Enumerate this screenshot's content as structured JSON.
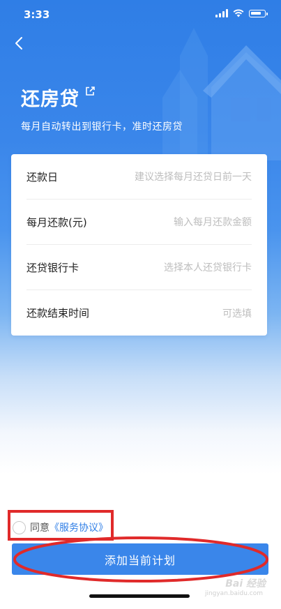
{
  "status": {
    "time": "3:33"
  },
  "header": {
    "back_icon": "chevron-left-icon",
    "title": "还房贷",
    "edit_icon": "external-edit-icon",
    "subtitle": "每月自动转出到银行卡，准时还房贷"
  },
  "form": {
    "rows": [
      {
        "label": "还款日",
        "placeholder": "建议选择每月还贷日前一天"
      },
      {
        "label": "每月还款(元)",
        "placeholder": "输入每月还款金额"
      },
      {
        "label": "还贷银行卡",
        "placeholder": "选择本人还贷银行卡"
      },
      {
        "label": "还款结束时间",
        "placeholder": "可选填"
      }
    ]
  },
  "agreement": {
    "prefix": "同意",
    "link": "《服务协议》"
  },
  "submit_label": "添加当前计划",
  "watermark": {
    "text": "Bai 经验",
    "sub": "jingyan.baidu.com"
  },
  "colors": {
    "accent": "#3a86ea",
    "highlight": "#e02a2a"
  }
}
